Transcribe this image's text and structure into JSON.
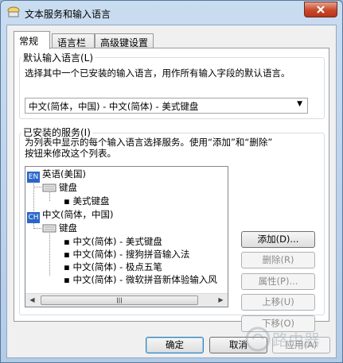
{
  "window": {
    "title": "文本服务和输入语言"
  },
  "tabs": [
    {
      "label": "常规",
      "active": true
    },
    {
      "label": "语言栏",
      "active": false
    },
    {
      "label": "高级键设置",
      "active": false
    }
  ],
  "default_language": {
    "group_label": "默认输入语言(L)",
    "description": "选择其中一个已安装的输入语言，用作所有输入字段的默认语言。",
    "selected": "中文(简体，中国) - 中文(简体) - 美式键盘"
  },
  "installed_services": {
    "group_label": "已安装的服务(I)",
    "description_line1": "为列表中显示的每个输入语言选择服务。使用“添加”和“删除”",
    "description_line2": "按钮来修改这个列表。",
    "tree": {
      "lang1": {
        "badge": "EN",
        "name": "英语(美国)"
      },
      "lang1_group": "键盘",
      "lang1_items": [
        "美式键盘"
      ],
      "lang2": {
        "badge": "CH",
        "name": "中文(简体，中国)"
      },
      "lang2_group": "键盘",
      "lang2_items": [
        "中文(简体) - 美式键盘",
        "中文(简体) - 搜狗拼音输入法",
        "中文(简体) - 极点五笔",
        "中文(简体) - 微软拼音新体验输入风"
      ]
    },
    "buttons": {
      "add": "添加(D)...",
      "remove": "删除(R)",
      "properties": "属性(P)...",
      "move_up": "上移(U)",
      "move_down": "下移(O)"
    }
  },
  "footer": {
    "ok": "确定",
    "cancel": "取消",
    "apply": "应用(A)"
  },
  "watermark": "路由器",
  "colors": {
    "accent": "#2a67c8",
    "close": "#c8482a"
  }
}
